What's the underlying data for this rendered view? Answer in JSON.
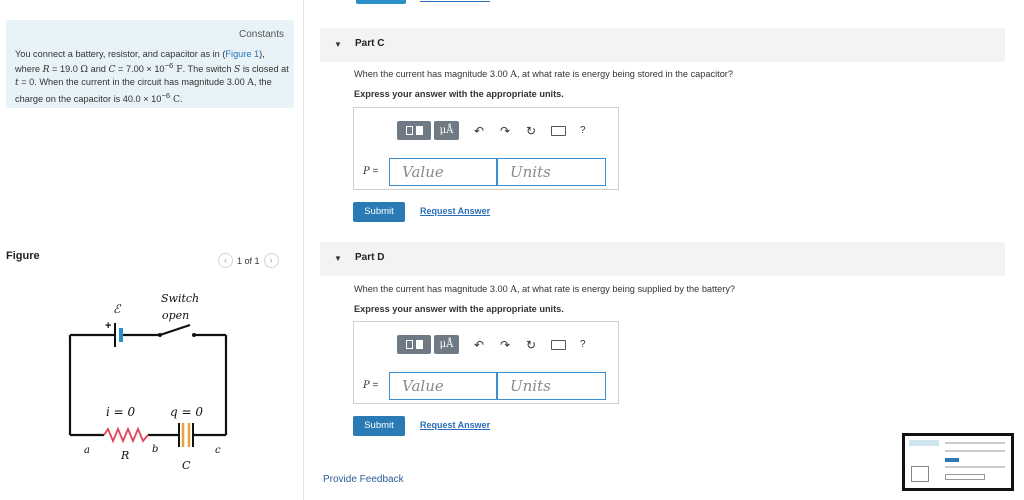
{
  "constants": {
    "link_label": "Constants",
    "problem": {
      "t1": "You connect a battery, resistor, and capacitor as in (",
      "figure_link": "Figure 1",
      "t2": "), where ",
      "R_sym": "R",
      "t3": " = 19.0 ",
      "ohm": "Ω",
      "t4": " and ",
      "C_sym": "C",
      "t5": " = 7.00 × 10",
      "exp1": "−6",
      "farad": " F",
      "t6": ". The switch ",
      "S_sym": "S",
      "t7": " is closed at ",
      "t_sym": "t",
      "t8": " = 0. When the current in the circuit has magnitude 3.00 ",
      "amp": "A",
      "t9": ", the charge on the capacitor is 40.0 × 10",
      "exp2": "−6",
      "coul": " C",
      "t10": "."
    }
  },
  "figure": {
    "label": "Figure",
    "pager_text": "1 of 1",
    "prev_icon": "chevron-left-icon",
    "next_icon": "chevron-right-icon",
    "circuit": {
      "emf": "ℰ",
      "plus": "+",
      "switch_line1": "Switch",
      "switch_line2": "open",
      "current": "i = 0",
      "charge": "q = 0",
      "node_a": "a",
      "node_b": "b",
      "node_c": "c",
      "resistor": "R",
      "capacitor": "C"
    }
  },
  "parts": [
    {
      "title": "Part C",
      "question_pre": "When the current has magnitude 3.00 ",
      "question_unit": "A",
      "question_post": ", at what rate is energy being stored in the capacitor?",
      "instruction": "Express your answer with the appropriate units.",
      "var_label": "P",
      "eq": " =",
      "value_placeholder": "Value",
      "units_placeholder": "Units",
      "submit_label": "Submit",
      "request_label": "Request Answer"
    },
    {
      "title": "Part D",
      "question_pre": "When the current has magnitude 3.00 ",
      "question_unit": "A",
      "question_post": ", at what rate is energy being supplied by the battery?",
      "instruction": "Express your answer with the appropriate units.",
      "var_label": "P",
      "eq": " =",
      "value_placeholder": "Value",
      "units_placeholder": "Units",
      "submit_label": "Submit",
      "request_label": "Request Answer"
    }
  ],
  "toolbar": {
    "mu_label": "μÅ",
    "help_label": "?",
    "icons": [
      "templates-icon",
      "units-icon",
      "undo-icon",
      "redo-icon",
      "reset-icon",
      "keyboard-icon",
      "help-icon"
    ]
  },
  "footer": {
    "feedback_label": "Provide Feedback"
  }
}
